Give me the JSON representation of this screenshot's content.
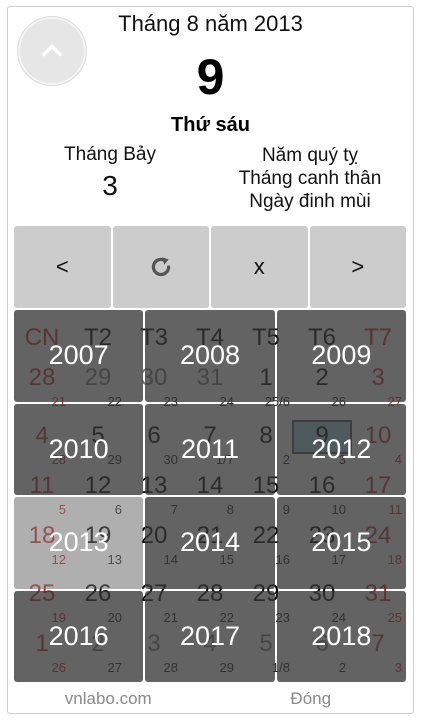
{
  "header": {
    "month_title": "Tháng 8 năm 2013",
    "day_number": "9",
    "weekday": "Thứ sáu",
    "lunar_month_name": "Tháng Bảy",
    "lunar_day": "3",
    "year_name": "Năm quý tỵ",
    "month_can_chi": "Tháng canh thân",
    "day_can_chi": "Ngày đinh mùi",
    "up_icon": "chevron-up-icon"
  },
  "nav": {
    "prev_label": "<",
    "refresh_icon": "refresh-icon",
    "close_label": "x",
    "next_label": ">"
  },
  "calendar": {
    "weekday_headers": [
      "CN",
      "T2",
      "T3",
      "T4",
      "T5",
      "T6",
      "T7"
    ],
    "weeks": [
      {
        "days": [
          "28",
          "29",
          "30",
          "31",
          "1",
          "2",
          "3"
        ],
        "lunar": [
          "21",
          "22",
          "23",
          "24",
          "25/6",
          "26",
          "27"
        ]
      },
      {
        "days": [
          "4",
          "5",
          "6",
          "7",
          "8",
          "9",
          "10"
        ],
        "lunar": [
          "28",
          "29",
          "30",
          "1/7",
          "2",
          "3",
          "4"
        ]
      },
      {
        "days": [
          "11",
          "12",
          "13",
          "14",
          "15",
          "16",
          "17"
        ],
        "lunar": [
          "5",
          "6",
          "7",
          "8",
          "9",
          "10",
          "11"
        ]
      },
      {
        "days": [
          "18",
          "19",
          "20",
          "21",
          "22",
          "23",
          "24"
        ],
        "lunar": [
          "12",
          "13",
          "14",
          "15",
          "16",
          "17",
          "18"
        ]
      },
      {
        "days": [
          "25",
          "26",
          "27",
          "28",
          "29",
          "30",
          "31"
        ],
        "lunar": [
          "19",
          "20",
          "21",
          "22",
          "23",
          "24",
          "25"
        ]
      },
      {
        "days": [
          "1",
          "2",
          "3",
          "4",
          "5",
          "6",
          "7"
        ],
        "lunar": [
          "26",
          "27",
          "28",
          "29",
          "1/8",
          "2",
          "3"
        ]
      }
    ]
  },
  "year_picker": {
    "years": [
      "2007",
      "2008",
      "2009",
      "2010",
      "2011",
      "2012",
      "2013",
      "2014",
      "2015",
      "2016",
      "2017",
      "2018"
    ],
    "selected": "2013"
  },
  "footer": {
    "left_label": "vnlabo.com",
    "right_label": "Đóng"
  },
  "colors": {
    "sunday_saturday": "#c0322f",
    "overlay": "#373737",
    "button_bg": "#cccccc"
  }
}
